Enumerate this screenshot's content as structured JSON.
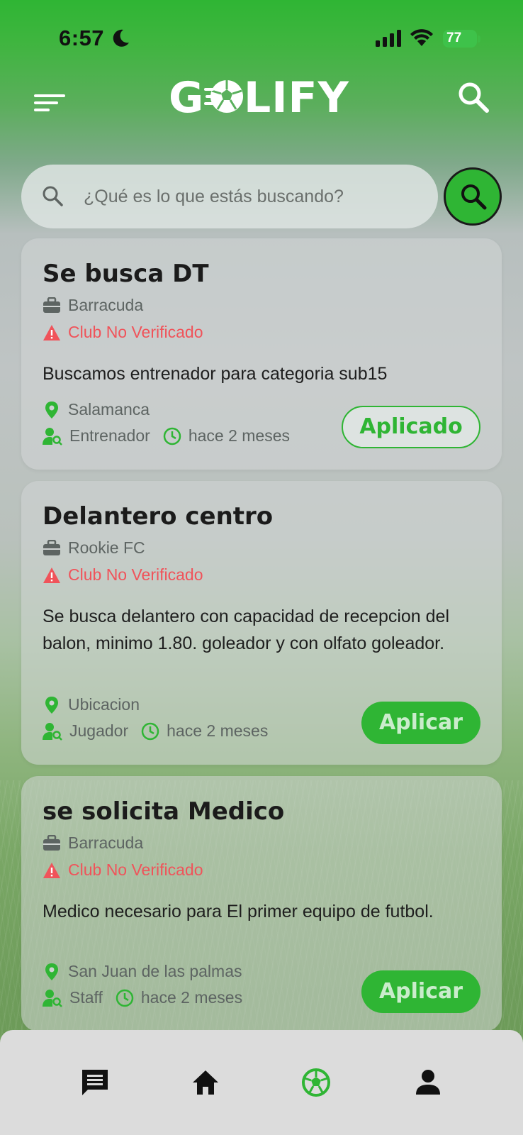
{
  "status_bar": {
    "time": "6:57",
    "battery": "77"
  },
  "header": {
    "logo_text_start": "G",
    "logo_text_end": "LIFY"
  },
  "search": {
    "placeholder": "¿Qué es lo que estás buscando?"
  },
  "colors": {
    "accent": "#2fb534",
    "warning": "#f0535a"
  },
  "jobs": [
    {
      "title": "Se busca DT",
      "club": "Barracuda",
      "verification": "Club No Verificado",
      "description": "Buscamos entrenador para categoria sub15",
      "location": "Salamanca",
      "role": "Entrenador",
      "posted": "hace 2 meses",
      "action": "Aplicado"
    },
    {
      "title": "Delantero centro",
      "club": "Rookie FC",
      "verification": "Club No Verificado",
      "description": "Se busca delantero con capacidad de recepcion del balon, minimo 1.80. goleador y con olfato goleador.",
      "location": "Ubicacion",
      "role": "Jugador",
      "posted": "hace 2 meses",
      "action": "Aplicar"
    },
    {
      "title": "se solicita Medico",
      "club": "Barracuda",
      "verification": "Club No Verificado",
      "description": "Medico necesario para El primer equipo de futbol.",
      "location": "San Juan de las palmas",
      "role": "Staff",
      "posted": "hace 2 meses",
      "action": "Aplicar"
    }
  ],
  "nav": [
    {
      "icon": "chat-icon"
    },
    {
      "icon": "home-icon"
    },
    {
      "icon": "soccer-ball-icon"
    },
    {
      "icon": "profile-icon"
    }
  ]
}
